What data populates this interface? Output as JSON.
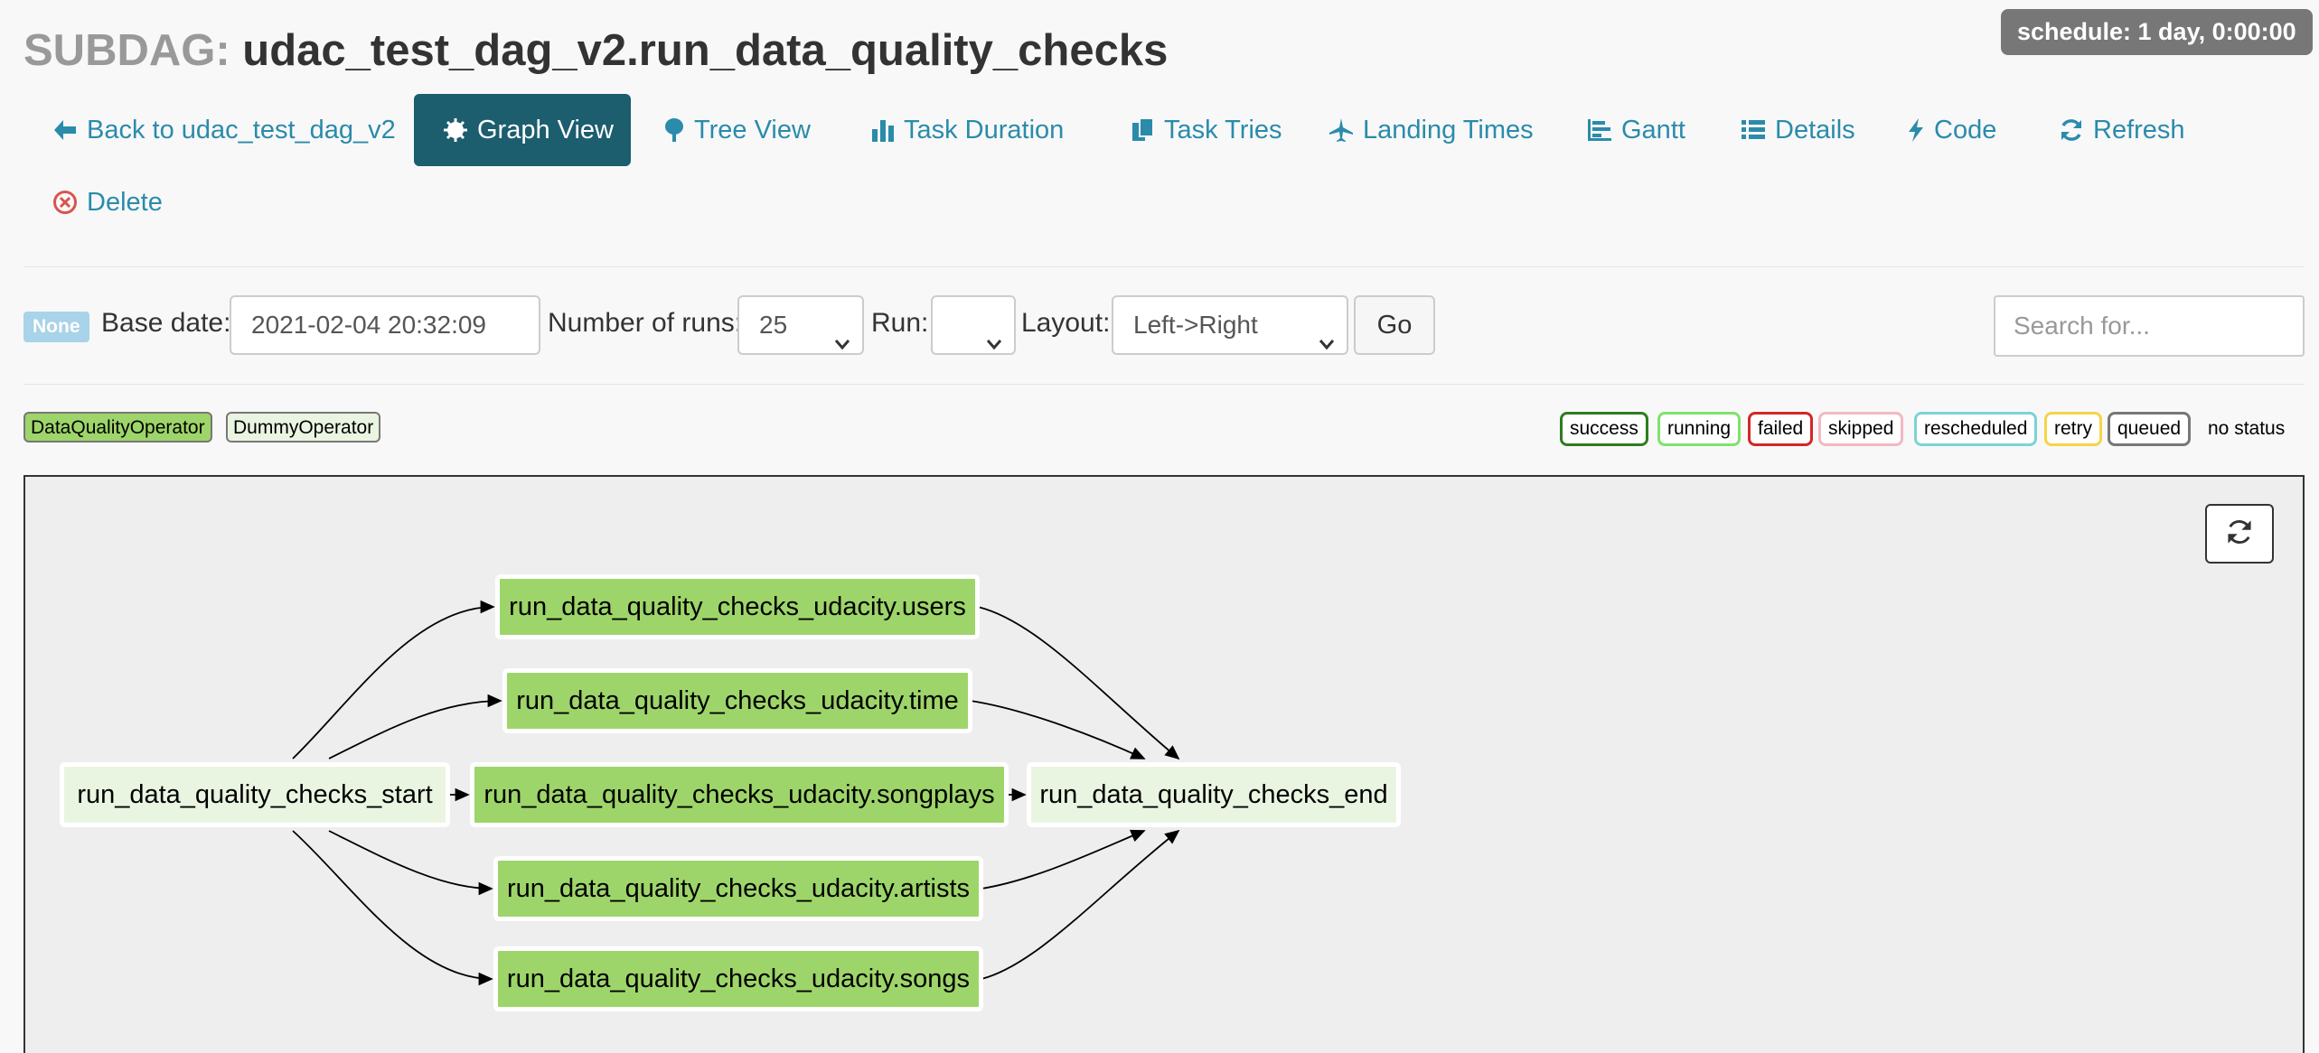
{
  "title": {
    "prefix": "SUBDAG:",
    "name": "udac_test_dag_v2.run_data_quality_checks"
  },
  "schedule_badge": "schedule: 1 day, 0:00:00",
  "nav": {
    "back": "Back to udac_test_dag_v2",
    "graph_view": "Graph View",
    "tree_view": "Tree View",
    "task_duration": "Task Duration",
    "task_tries": "Task Tries",
    "landing_times": "Landing Times",
    "gantt": "Gantt",
    "details": "Details",
    "code": "Code",
    "refresh": "Refresh",
    "delete": "Delete"
  },
  "form": {
    "state_badge": "None",
    "base_date_label": "Base date:",
    "base_date_value": "2021-02-04 20:32:09",
    "num_runs_label": "Number of runs:",
    "num_runs_value": "25",
    "run_label": "Run:",
    "run_value": "",
    "layout_label": "Layout:",
    "layout_value": "Left->Right",
    "go_label": "Go",
    "search_placeholder": "Search for..."
  },
  "operators": [
    {
      "label": "DataQualityOperator",
      "color": "#9ed56a"
    },
    {
      "label": "DummyOperator",
      "color": "#eaf5e1"
    }
  ],
  "states": [
    {
      "label": "success",
      "color": "#2e7d1f"
    },
    {
      "label": "running",
      "color": "#7ee36b"
    },
    {
      "label": "failed",
      "color": "#d62626"
    },
    {
      "label": "skipped",
      "color": "#f2b8c4"
    },
    {
      "label": "rescheduled",
      "color": "#7bd4d4"
    },
    {
      "label": "retry",
      "color": "#f5d547"
    },
    {
      "label": "queued",
      "color": "#777777"
    },
    {
      "label": "no status",
      "color": ""
    }
  ],
  "graph": {
    "nodes": {
      "start": "run_data_quality_checks_start",
      "users": "run_data_quality_checks_udacity.users",
      "time": "run_data_quality_checks_udacity.time",
      "songplays": "run_data_quality_checks_udacity.songplays",
      "artists": "run_data_quality_checks_udacity.artists",
      "songs": "run_data_quality_checks_udacity.songs",
      "end": "run_data_quality_checks_end"
    }
  },
  "colors": {
    "accent": "#2a8bab",
    "active_tab": "#1c5d6e",
    "dq_operator": "#9ed56a",
    "dummy_operator": "#eaf5e1"
  }
}
